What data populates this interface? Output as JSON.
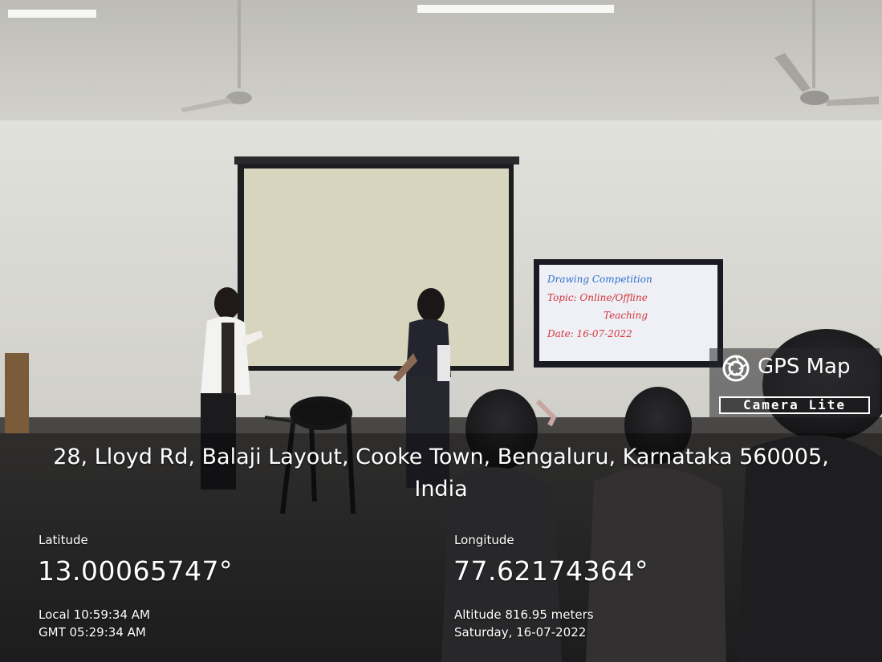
{
  "screen": {
    "line1": "Drawing Competition",
    "line2": "Topic: Online/Offline",
    "line3": "Teaching",
    "line4": "Date: 16-07-2022"
  },
  "badge": {
    "title": "GPS Map",
    "subtitle": "Camera Lite",
    "icon": "camera-lens-icon"
  },
  "location": {
    "address_line1": "28, Lloyd Rd, Balaji Layout, Cooke Town, Bengaluru, Karnataka 560005,",
    "address_line2": "India",
    "latitude_label": "Latitude",
    "latitude_value": "13.00065747°",
    "longitude_label": "Longitude",
    "longitude_value": "77.62174364°",
    "local_time": "Local 10:59:34 AM",
    "gmt_time": "GMT 05:29:34 AM",
    "altitude": "Altitude 816.95 meters",
    "date": "Saturday, 16-07-2022"
  },
  "colors": {
    "wall": "#d9d8d3",
    "ceiling": "#c9c8c3",
    "projector_screen": "#d8d5bf",
    "tv_frame": "#1a1b22",
    "tv_screen": "#eef0f6"
  }
}
